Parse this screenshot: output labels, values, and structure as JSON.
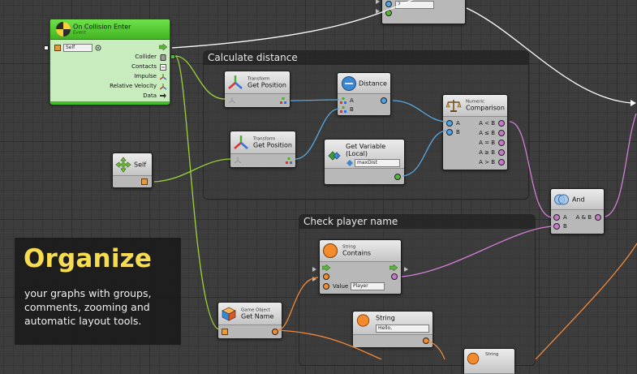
{
  "overlay": {
    "title": "Organize",
    "subtitle": "your graphs with groups, comments, zooming and automatic layout tools."
  },
  "groups": {
    "calc": "Calculate distance",
    "check": "Check player name"
  },
  "nodes": {
    "collision": {
      "title": "On Collision Enter",
      "kind": "Event",
      "target_value": "Self",
      "outputs": [
        "Collider",
        "Contacts",
        "Impulse",
        "Relative Velocity",
        "Data"
      ]
    },
    "top_partial": {
      "value": "2"
    },
    "self": {
      "label": "Self"
    },
    "getpos1": {
      "small": "Transform",
      "big": "Get Position"
    },
    "getpos2": {
      "small": "Transform",
      "big": "Get Position"
    },
    "distance": {
      "title": "Distance",
      "in_a": "A",
      "in_b": "B"
    },
    "getvar": {
      "title": "Get Variable",
      "sub": "(Local)",
      "var_name": "maxDist"
    },
    "numcmp": {
      "small": "Numeric",
      "big": "Comparison",
      "in_a": "A",
      "in_b": "B",
      "outputs": [
        "A < B",
        "A ≤ B",
        "A = B",
        "A ≥ B",
        "A > B"
      ]
    },
    "and": {
      "title": "And",
      "in_a": "A",
      "in_b": "B",
      "out": "A & B"
    },
    "contains": {
      "small": "String",
      "big": "Contains",
      "value_label": "Value",
      "value": "Player"
    },
    "getname": {
      "small": "Game Object",
      "big": "Get Name"
    },
    "string1": {
      "title": "String",
      "value": "Hello,"
    },
    "string2": {
      "title": "String"
    }
  },
  "colors": {
    "accent_yellow": "#f7dc52",
    "event_green": "#5fcf3c",
    "wire_blue": "#5aa8e0",
    "wire_pink": "#d17fd6",
    "wire_orange": "#f0893a",
    "wire_green": "#9bd23a",
    "wire_white": "#ffffff"
  }
}
